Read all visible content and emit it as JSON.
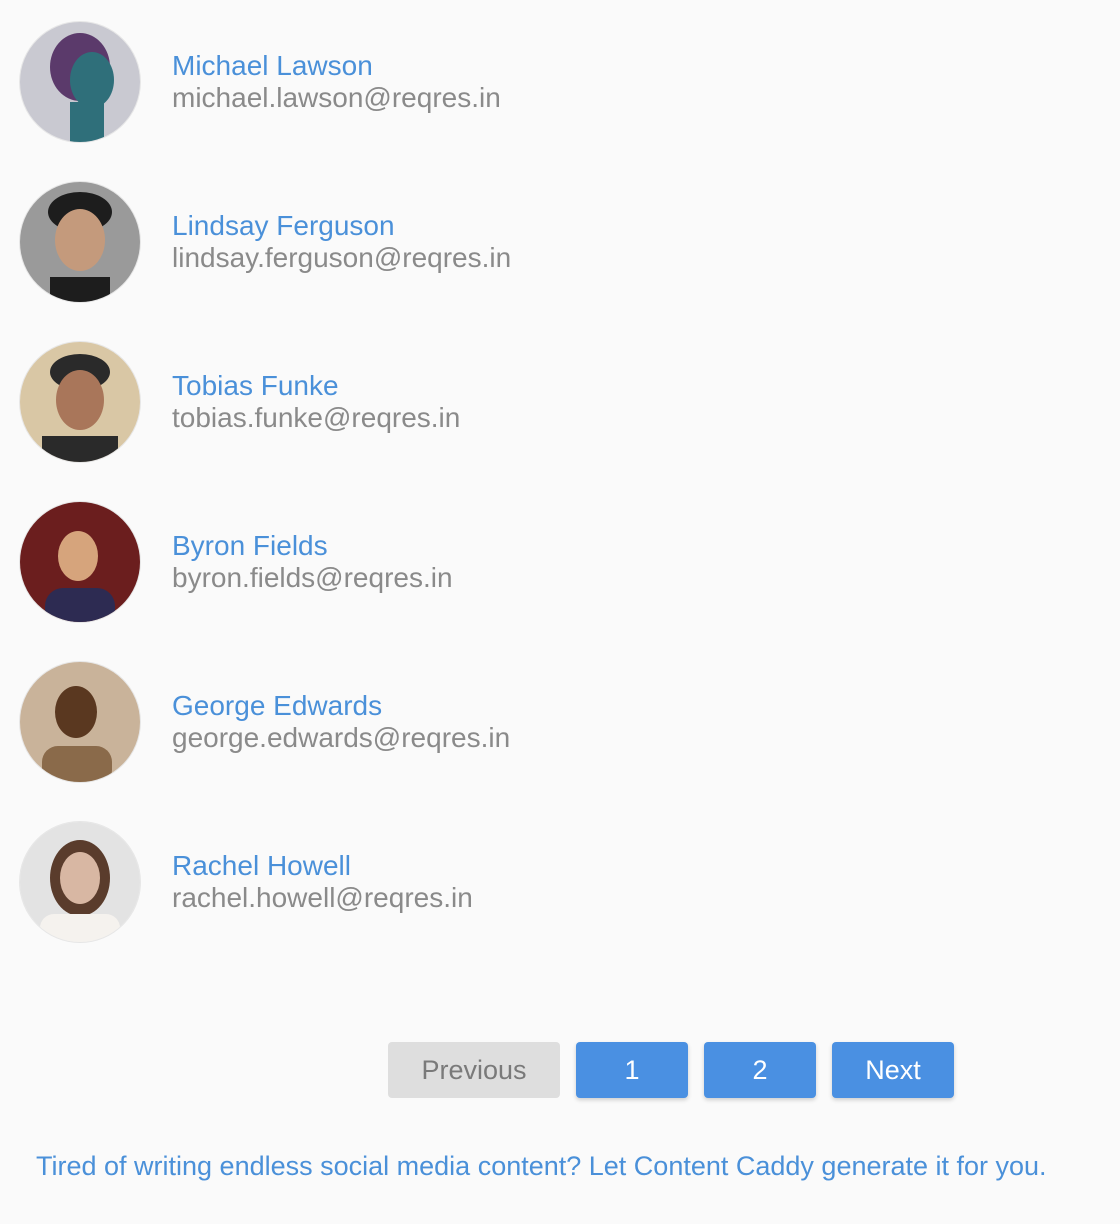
{
  "users": [
    {
      "name": "Michael Lawson",
      "email": "michael.lawson@reqres.in",
      "avatar_colors": [
        "#c9c9d1",
        "#5b3a6b",
        "#2f6f7a"
      ]
    },
    {
      "name": "Lindsay Ferguson",
      "email": "lindsay.ferguson@reqres.in",
      "avatar_colors": [
        "#9a9a9a",
        "#c49a7c",
        "#1d1d1d"
      ]
    },
    {
      "name": "Tobias Funke",
      "email": "tobias.funke@reqres.in",
      "avatar_colors": [
        "#d9c7a5",
        "#a9765a",
        "#2a2a2a"
      ]
    },
    {
      "name": "Byron Fields",
      "email": "byron.fields@reqres.in",
      "avatar_colors": [
        "#6b1e1e",
        "#d6a47c",
        "#2d2b52"
      ]
    },
    {
      "name": "George Edwards",
      "email": "george.edwards@reqres.in",
      "avatar_colors": [
        "#c9b39a",
        "#5a3820",
        "#8a6a4a"
      ]
    },
    {
      "name": "Rachel Howell",
      "email": "rachel.howell@reqres.in",
      "avatar_colors": [
        "#e3e3e3",
        "#d8b7a3",
        "#5a3c2c"
      ]
    }
  ],
  "pagination": {
    "previous_label": "Previous",
    "page_1_label": "1",
    "page_2_label": "2",
    "next_label": "Next"
  },
  "promo": {
    "text": "Tired of writing endless social media content? Let Content Caddy generate it for you."
  },
  "colors": {
    "link": "#4a90d9",
    "email": "#8a8a8a",
    "button": "#4a90e2",
    "button_disabled": "#dedede"
  }
}
